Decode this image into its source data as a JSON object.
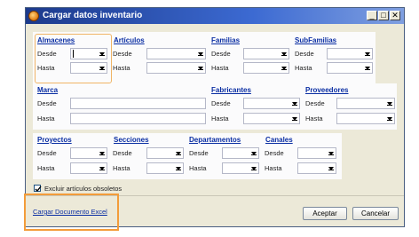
{
  "window": {
    "title": "Cargar datos inventario",
    "minimize": "_",
    "maximize": "□",
    "close": "✕"
  },
  "labels": {
    "desde": "Desde",
    "hasta": "Hasta"
  },
  "groups": {
    "almacenes": "Almacenes",
    "articulos": "Artículos",
    "familias": "Familias",
    "subfamilias": "SubFamilias",
    "marca": "Marca",
    "fabricantes": "Fabricantes",
    "proveedores": "Proveedores",
    "proyectos": "Proyectos",
    "secciones": "Secciones",
    "departamentos": "Departamentos",
    "canales": "Canales"
  },
  "checkbox": {
    "label": "Excluir artículos obsoletos",
    "checked": true
  },
  "footer": {
    "link": "Cargar Documento Excel",
    "accept": "Aceptar",
    "cancel": "Cancelar"
  },
  "colors": {
    "highlight": "#f39c3a",
    "link": "#0a2ea3",
    "titlebar": "#1c3a8c"
  }
}
